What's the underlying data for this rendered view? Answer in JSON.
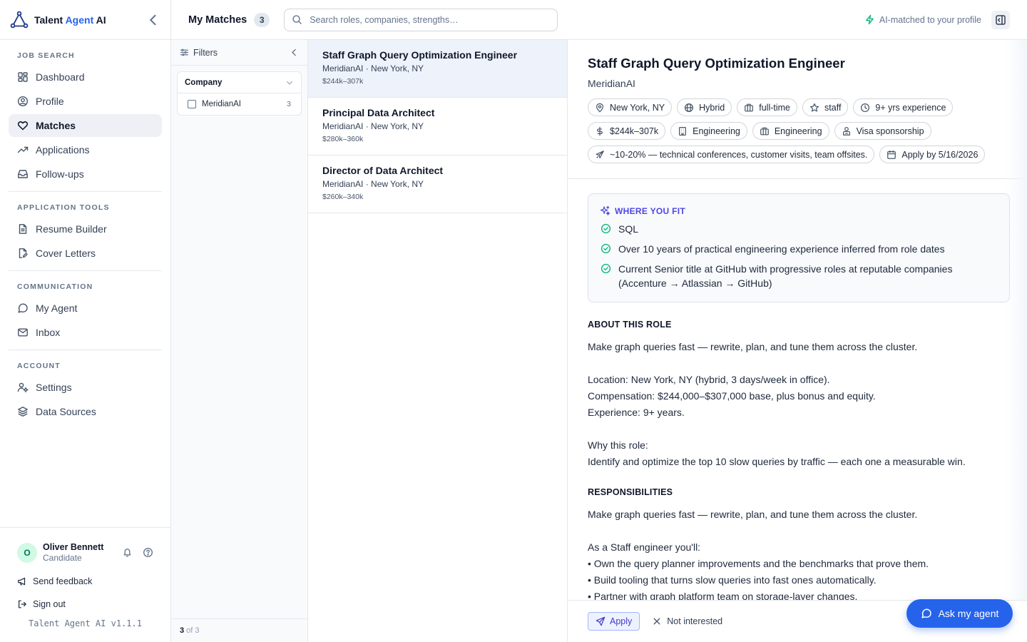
{
  "brand": {
    "name_prefix": "Talent ",
    "name_accent": "Agent",
    "name_suffix": " AI"
  },
  "sidebar": {
    "sections": [
      {
        "heading": "JOB SEARCH",
        "items": [
          {
            "label": "Dashboard",
            "icon": "dashboard-icon"
          },
          {
            "label": "Profile",
            "icon": "profile-icon"
          },
          {
            "label": "Matches",
            "icon": "heart-icon",
            "active": true
          },
          {
            "label": "Applications",
            "icon": "trending-icon"
          },
          {
            "label": "Follow-ups",
            "icon": "inbox-tray-icon"
          }
        ]
      },
      {
        "heading": "APPLICATION TOOLS",
        "items": [
          {
            "label": "Resume Builder",
            "icon": "document-icon"
          },
          {
            "label": "Cover Letters",
            "icon": "document-edit-icon"
          }
        ]
      },
      {
        "heading": "COMMUNICATION",
        "items": [
          {
            "label": "My Agent",
            "icon": "chat-icon"
          },
          {
            "label": "Inbox",
            "icon": "mail-icon"
          }
        ]
      },
      {
        "heading": "ACCOUNT",
        "items": [
          {
            "label": "Settings",
            "icon": "user-settings-icon"
          },
          {
            "label": "Data Sources",
            "icon": "layers-icon"
          }
        ]
      }
    ],
    "user": {
      "initial": "O",
      "name": "Oliver Bennett",
      "role": "Candidate"
    },
    "send_feedback": "Send feedback",
    "sign_out": "Sign out",
    "version": "Talent Agent AI v1.1.1"
  },
  "topbar": {
    "title": "My Matches",
    "count": "3",
    "search_placeholder": "Search roles, companies, strengths…",
    "ai_matched": "AI-matched to your profile"
  },
  "filters": {
    "title": "Filters",
    "group_title": "Company",
    "options": [
      {
        "label": "MeridianAI",
        "count": "3"
      }
    ],
    "shown": "3",
    "total_text": "of 3"
  },
  "jobs": [
    {
      "title": "Staff Graph Query Optimization Engineer",
      "sub": "MeridianAI · New York, NY",
      "pay": "$244k–307k",
      "selected": true
    },
    {
      "title": "Principal Data Architect",
      "sub": "MeridianAI · New York, NY",
      "pay": "$280k–360k"
    },
    {
      "title": "Director of Data Architect",
      "sub": "MeridianAI · New York, NY",
      "pay": "$260k–340k"
    }
  ],
  "detail": {
    "title": "Staff Graph Query Optimization Engineer",
    "company": "MeridianAI",
    "chips": [
      {
        "icon": "location-pin-icon",
        "label": "New York, NY"
      },
      {
        "icon": "globe-icon",
        "label": "Hybrid"
      },
      {
        "icon": "briefcase-icon",
        "label": "full-time"
      },
      {
        "icon": "star-icon",
        "label": "staff"
      },
      {
        "icon": "clock-icon",
        "label": "9+ yrs experience"
      },
      {
        "icon": "dollar-icon",
        "label": "$244k–307k"
      },
      {
        "icon": "building-icon",
        "label": "Engineering"
      },
      {
        "icon": "briefcase-icon",
        "label": "Engineering"
      },
      {
        "icon": "passport-icon",
        "label": "Visa sponsorship"
      },
      {
        "icon": "plane-icon",
        "label": "~10-20% — technical conferences, customer visits, team offsites."
      },
      {
        "icon": "calendar-icon",
        "label": "Apply by 5/16/2026"
      }
    ],
    "fit_heading": "WHERE YOU FIT",
    "fit_items": [
      "SQL",
      "Over 10 years of practical engineering experience inferred from role dates",
      "Current Senior title at GitHub with progressive roles at reputable companies (Accenture → Atlassian → GitHub)"
    ],
    "about_heading": "ABOUT THIS ROLE",
    "about_body": "Make graph queries fast — rewrite, plan, and tune them across the cluster.\n\nLocation: New York, NY (hybrid, 3 days/week in office).\nCompensation: $244,000–$307,000 base, plus bonus and equity.\nExperience: 9+ years.\n\nWhy this role:\nIdentify and optimize the top 10 slow queries by traffic — each one a measurable win.",
    "resp_heading": "RESPONSIBILITIES",
    "resp_body": "Make graph queries fast — rewrite, plan, and tune them across the cluster.\n\nAs a Staff engineer you'll:\n• Own the query planner improvements and the benchmarks that prove them.\n• Build tooling that turns slow queries into fast ones automatically.\n• Partner with graph platform team on storage-layer changes.",
    "apply_label": "Apply",
    "not_interested_label": "Not interested"
  },
  "ask_agent_label": "Ask my agent",
  "colors": {
    "accent": "#2563eb",
    "success": "#10b981",
    "fit_heading": "#4f46e5"
  }
}
